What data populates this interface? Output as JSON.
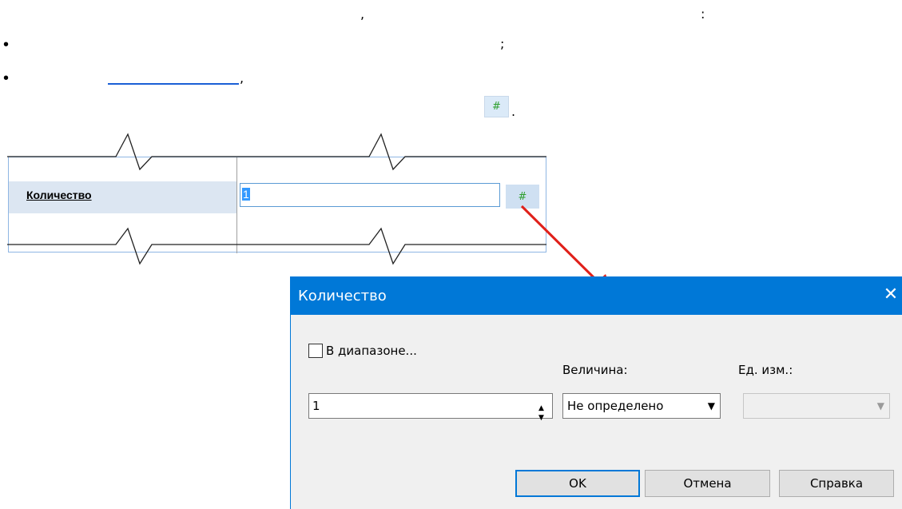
{
  "doc": {
    "comma_1": ",",
    "colon_1": ":",
    "semicolon_1": ";",
    "comma_2": ",",
    "period_1": ".",
    "bullet": "•"
  },
  "inline_button": {
    "icon": "#"
  },
  "property_grid": {
    "label": "Количество",
    "value": "1",
    "button_icon": "#"
  },
  "dialog": {
    "title": "Количество",
    "close": "✕",
    "range_checkbox_label": "В диапазоне...",
    "range_checked": false,
    "value_field": "1",
    "magnitude_label": "Величина:",
    "magnitude_selected": "Не определено",
    "unit_label": "Ед. изм.:",
    "unit_selected": "",
    "ok": "OK",
    "cancel": "Отмена",
    "help": "Справка"
  },
  "colors": {
    "titlebar": "#0078d7",
    "dialog_bg": "#f0f0f0",
    "arrow": "#e0201a",
    "link": "#1a5fd6",
    "hash_green": "#2e9f2e"
  }
}
